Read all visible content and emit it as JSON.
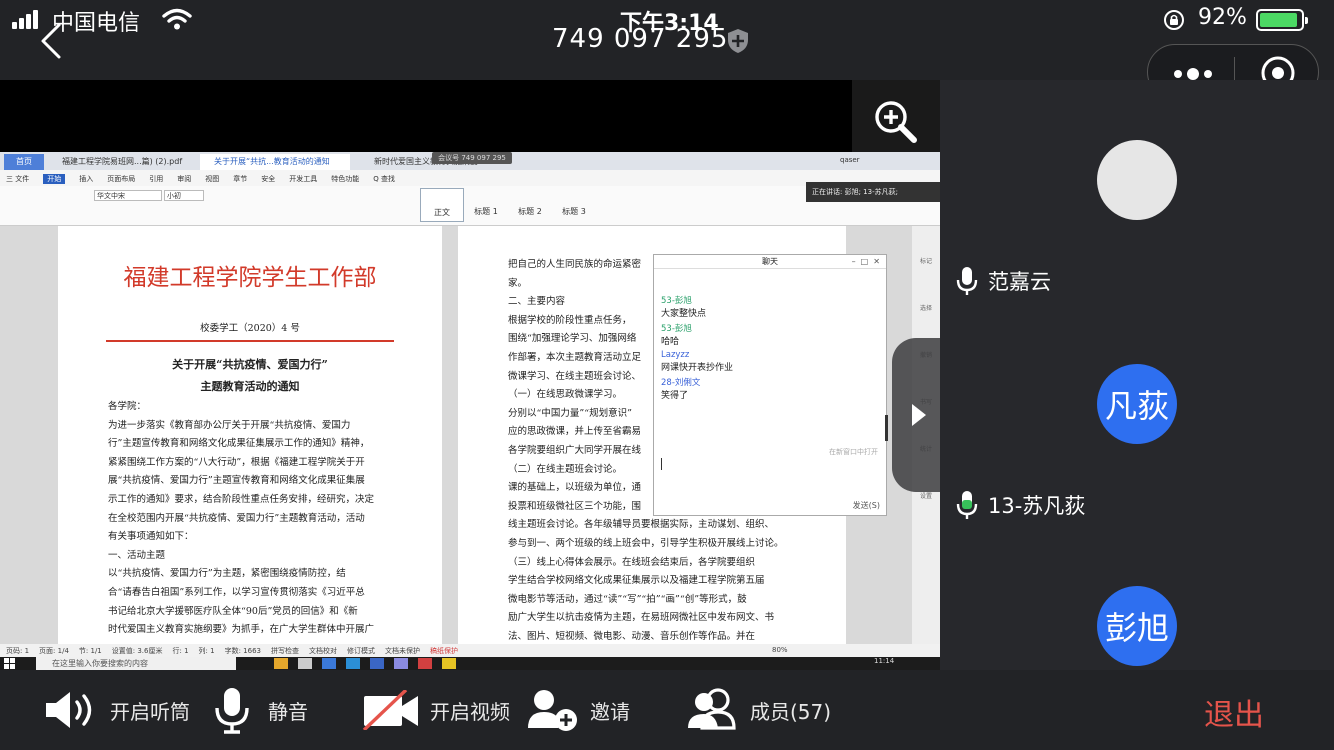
{
  "status": {
    "carrier": "中国电信",
    "time": "下午3:14",
    "battery": "92%",
    "battery_level": 0.92
  },
  "meeting": {
    "id": "749 097 295"
  },
  "shared_window": {
    "tabs": [
      "首页",
      "福建工程学院易班网...篇) (2).pdf",
      "关于开展“共抗...教育活动的通知",
      "新时代爱国主义教育实施纲要"
    ],
    "tab_badge": "会议号 749 097 295",
    "user": "qaser",
    "menu": [
      "三 文件",
      "开始",
      "插入",
      "页面布局",
      "引用",
      "审阅",
      "视图",
      "章节",
      "安全",
      "开发工具",
      "特色功能",
      "Q 查找"
    ],
    "ribbon_fonts": [
      "华文中宋",
      "小初"
    ],
    "styles": [
      "正文",
      "标题 1",
      "标题 2",
      "标题 3"
    ],
    "notice": "正在讲话: 彭旭; 13-苏凡荻;",
    "doc_left": {
      "org": "福建工程学院学生工作部",
      "doc_no": "校委学工（2020）4 号",
      "title1": "关于开展“共抗疫情、爱国力行”",
      "title2": "主题教育活动的通知",
      "lines": [
        "各学院：",
        "    为进一步落实《教育部办公厅关于开展“共抗疫情、爱国力",
        "行”主题宣传教育和网络文化成果征集展示工作的通知》精神，",
        "紧紧围绕工作方案的“八大行动”，根据《福建工程学院关于开",
        "展“共抗疫情、爱国力行”主题宣传教育和网络文化成果征集展",
        "示工作的通知》要求，结合阶段性重点任务安排，经研究，决定",
        "在全校范围内开展“共抗疫情、爱国力行”主题教育活动，活动",
        "有关事项通知如下：",
        "    一、活动主题",
        "    以“共抗疫情、爱国力行”为主题，紧密围绕疫情防控，结",
        "合“请春告白祖国”系列工作，以学习宣传贯彻落实《习近平总",
        "书记给北京大学援鄂医疗队全体“90后”党员的回信》和《新",
        "时代爱国主义教育实施纲要》为抓手，在广大学生群体中开展广"
      ]
    },
    "doc_right": {
      "lines": [
        "把自己的人生同民族的命运紧密",
        "家。",
        "    二、主要内容",
        "    根据学校的阶段性重点任务，",
        "围绕“加强理论学习、加强网络",
        "作部署，本次主题教育活动立足",
        "微课学习、在线主题班会讨论、",
        "    （一）在线思政微课学习。",
        "分别以“中国力量”“规划意识”",
        "应的思政微课，并上传至省霸易",
        "各学院要组织广大同学开展在线",
        "    （二）在线主题班会讨论。",
        "课的基础上，以班级为单位，通",
        "投票和班级微社区三个功能，围",
        "线主题班会讨论。各年级辅导员要根据实际，主动谋划、组织、",
        "参与到一、两个班级的线上班会中，引导学生积极开展线上讨论。",
        "    （三）线上心得体会展示。在线班会结束后，各学院要组织",
        "学生结合学校网络文化成果征集展示以及福建工程学院第五届",
        "微电影节等活动，通过“读”“写”“拍”“画”“创”等形式，鼓",
        "励广大学生以抗击疫情为主题，在易班网微社区中发布网文、书",
        "法、图片、短视频、微电影、动漫、音乐创作等作品。并在"
      ]
    },
    "chat": {
      "title": "聊天",
      "messages": [
        {
          "name": "53-彭旭",
          "text": "大家整快点",
          "color": "green"
        },
        {
          "name": "53-彭旭",
          "text": "哈哈",
          "color": "green"
        },
        {
          "name": "Lazyzz",
          "text": "网课快开表抄作业",
          "color": "blue"
        },
        {
          "name": "28-刘俐文",
          "text": "笑得了",
          "color": "blue"
        }
      ],
      "open_window": "在新窗口中打开",
      "send": "发送(S)"
    },
    "status_bar": {
      "page": "页码: 1",
      "section": "页面: 1/4",
      "sec": "节: 1/1",
      "pos": "设置值: 3.6厘米",
      "row": "行: 1",
      "col": "列: 1",
      "words": "字数: 1663",
      "spell": "拼写检查",
      "proof": "文档校对",
      "mode": "修订模式",
      "protect": "文档未保护",
      "help": "稿纸保护",
      "zoom": "80%"
    },
    "taskbar": {
      "search": "在这里输入你要搜索的内容",
      "clock": "11:14"
    }
  },
  "side_tools": [
    "标记",
    "选择",
    "撤销",
    "书写",
    "统计",
    "设置"
  ],
  "participants": [
    {
      "name": "范嘉云",
      "avatar": "",
      "color": "#e6e6e6",
      "mic": "on"
    },
    {
      "name": "13-苏凡荻",
      "avatar": "凡荻",
      "color": "#2e6ff0",
      "mic": "speaking"
    },
    {
      "name": "",
      "avatar": "彭旭",
      "color": "#2e6ff0",
      "mic": ""
    }
  ],
  "toolbar": {
    "speaker": "开启听筒",
    "mute": "静音",
    "video": "开启视频",
    "invite": "邀请",
    "members": "成员(57)",
    "exit": "退出"
  }
}
